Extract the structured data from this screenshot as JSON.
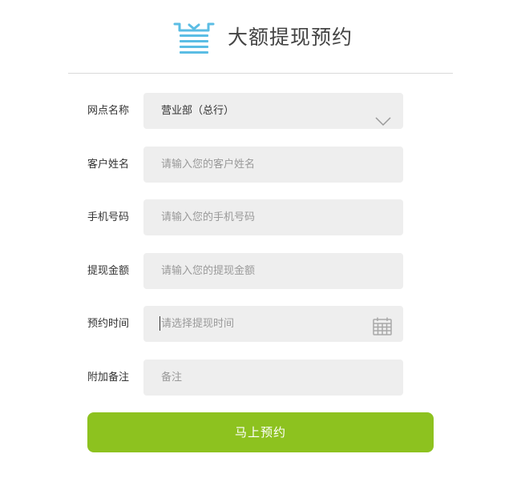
{
  "header": {
    "icon": "atm-withdraw-icon",
    "title": "大额提现预约",
    "accent_color": "#5bbde4"
  },
  "form": {
    "branch": {
      "label": "网点名称",
      "value": "营业部（总行）",
      "icon": "chevron-down-icon"
    },
    "name": {
      "label": "客户姓名",
      "placeholder": "请输入您的客户姓名"
    },
    "phone": {
      "label": "手机号码",
      "placeholder": "请输入您的手机号码"
    },
    "amount": {
      "label": "提现金额",
      "placeholder": "请输入您的提现金额"
    },
    "time": {
      "label": "预约时间",
      "placeholder": "请选择提现时间",
      "icon": "calendar-icon"
    },
    "remark": {
      "label": "附加备注",
      "placeholder": "备注"
    }
  },
  "submit": {
    "label": "马上预约",
    "color": "#8dc21f"
  }
}
